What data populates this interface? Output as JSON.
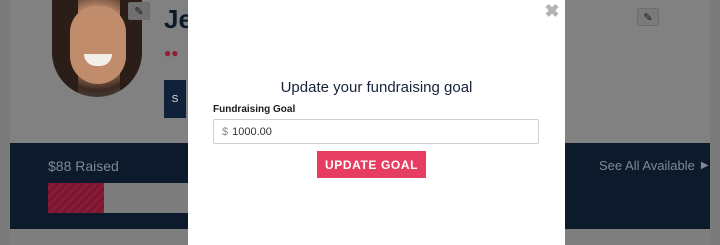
{
  "background": {
    "name": "Je",
    "raised_label": "$88 Raised",
    "see_all_label": "See All Available",
    "progress_fraction": 0.4,
    "icons": {
      "edit": "pencil-icon",
      "team": "users-icon",
      "arrow": "caret-right-icon"
    }
  },
  "modal": {
    "title": "Update your fundraising goal",
    "field_label": "Fundraising Goal",
    "currency_symbol": "$",
    "goal_value": "1000.00",
    "submit_label": "UPDATE GOAL",
    "close_icon": "close-icon"
  },
  "colors": {
    "accent": "#e83d62",
    "overlay": "#808080",
    "navy": "#0c1a2c"
  }
}
